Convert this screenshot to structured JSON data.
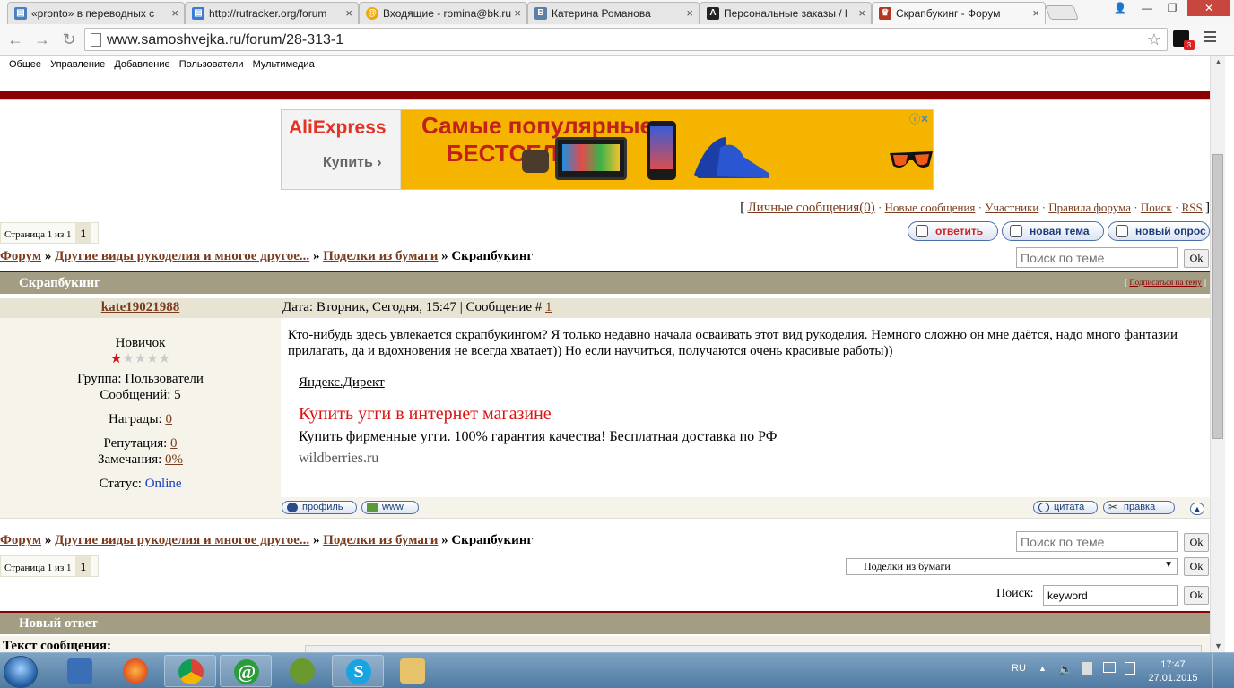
{
  "browser": {
    "tabs": [
      {
        "title": "«pronto» в переводных с",
        "icon_color": "#4a7fc1"
      },
      {
        "title": "http://rutracker.org/forum",
        "icon_color": "#3a7bd5"
      },
      {
        "title": "Входящие - romina@bk.ru",
        "icon_color": "#f0a800"
      },
      {
        "title": "Катерина Романова",
        "icon_color": "#5b7fa6"
      },
      {
        "title": "Персональные заказы / l",
        "icon_color": "#222222"
      },
      {
        "title": "Скрапбукинг - Форум",
        "icon_color": "#b5371f"
      }
    ],
    "url": "www.samoshvejka.ru/forum/28-313-1",
    "ext_badge": "3"
  },
  "adminbar": [
    "Общее",
    "Управление",
    "Добавление",
    "Пользователи",
    "Мультимедиа"
  ],
  "ad": {
    "brand": "AliExpress",
    "buy_label": "Купить",
    "headline_1": "Самые популярные",
    "headline_2": "БЕСТСЕЛЛЕРЫ"
  },
  "userlinks": {
    "pm": "Личные сообщения(0)",
    "new": "Новые сообщения",
    "members": "Участники",
    "rules": "Правила форума",
    "search": "Поиск",
    "rss": "RSS"
  },
  "pager": {
    "label": "Страница 1 из 1",
    "current": "1"
  },
  "actions": {
    "reply": "ответить",
    "new_topic": "новая тема",
    "new_poll": "новый опрос"
  },
  "breadcrumb": {
    "forum": "Форум",
    "category": "Другие виды рукоделия и многое другое...",
    "subforum": "Поделки из бумаги",
    "current": "Скрапбукинг",
    "sep": "»"
  },
  "topic_search": {
    "placeholder": "Поиск по теме",
    "ok": "Ok"
  },
  "topic": {
    "title": "Скрапбукинг",
    "subscribe": "Подписаться на тему"
  },
  "post": {
    "author": "kate19021988",
    "date_label": "Дата: Вторник, Сегодня, 15:47 | Сообщение #",
    "number": "1",
    "rank": "Новичок",
    "stars": "★★★★★",
    "group": "Группа: Пользователи",
    "messages": "Сообщений: 5",
    "awards_label": "Награды:",
    "awards": "0",
    "reputation_label": "Репутация:",
    "reputation": "0",
    "warnings_label": "Замечания:",
    "warnings": "0%",
    "status_label": "Статус:",
    "status": "Online",
    "text": "Кто-нибудь здесь увлекается скрапбукингом? Я только недавно начала осваивать этот вид рукоделия. Немного сложно он мне даётся, надо много фантазии прилагать, да и вдохновения не всегда хватает)) Но если научиться, получаются очень красивые работы))",
    "direct_label": "Яндекс.Директ",
    "direct_title": "Купить угги в интернет магазине",
    "direct_text": "Купить фирменные угги. 100% гарантия качества! Бесплатная доставка по РФ",
    "direct_domain": "wildberries.ru",
    "btn_profile": "профиль",
    "btn_www": "www",
    "btn_quote": "цитата",
    "btn_edit": "правка"
  },
  "jump": {
    "selected": "Поделки из бумаги",
    "ok": "Ok"
  },
  "forum_search": {
    "label": "Поиск:",
    "value": "keyword",
    "ok": "Ok"
  },
  "reply": {
    "title": "Новый ответ",
    "text_label": "Текст сообщения:"
  },
  "tray": {
    "lang": "RU",
    "time": "17:47",
    "date": "27.01.2015"
  }
}
